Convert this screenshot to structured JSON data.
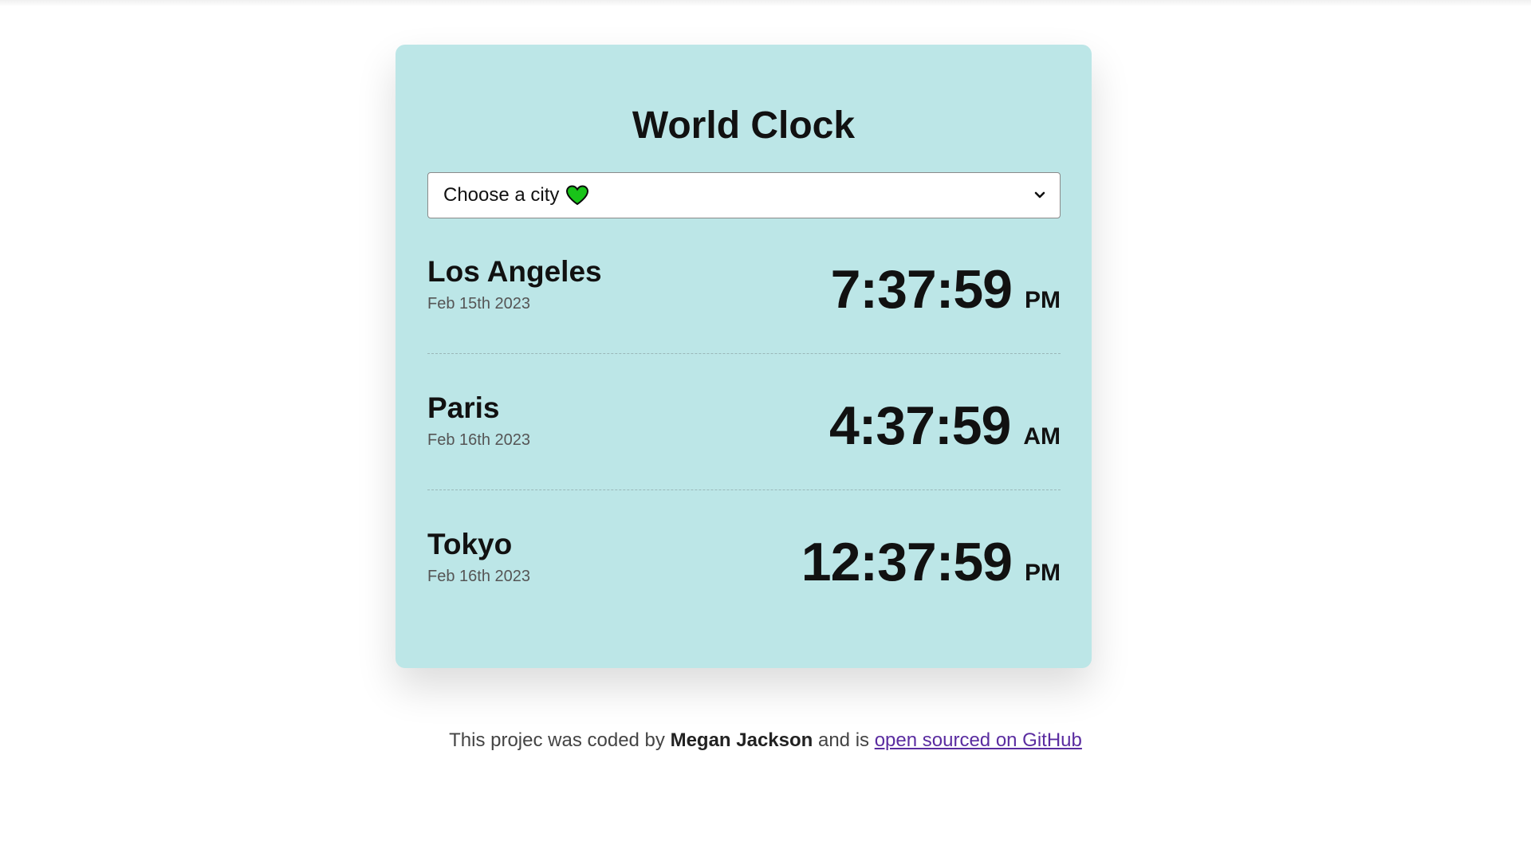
{
  "app": {
    "title": "World Clock"
  },
  "city_select": {
    "label": "Choose a city",
    "icon": "green-heart-icon",
    "heart_color": "#19c419"
  },
  "cities": [
    {
      "name": "Los Angeles",
      "date": "Feb 15th 2023",
      "time": "7:37:59",
      "ampm": "PM"
    },
    {
      "name": "Paris",
      "date": "Feb 16th 2023",
      "time": "4:37:59",
      "ampm": "AM"
    },
    {
      "name": "Tokyo",
      "date": "Feb 16th 2023",
      "time": "12:37:59",
      "ampm": "PM"
    }
  ],
  "footer": {
    "prefix": "This projec was coded by",
    "author": "Megan Jackson",
    "middle": "and is",
    "link_text": "open sourced on GitHub"
  },
  "colors": {
    "card_background": "#bce6e7",
    "link": "#5a2ca0"
  }
}
